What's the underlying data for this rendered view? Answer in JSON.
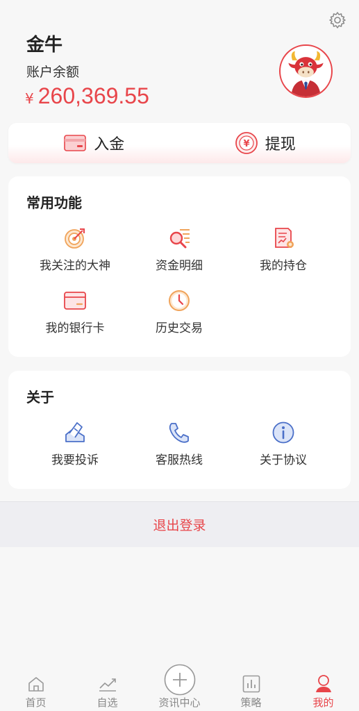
{
  "user": {
    "name": "金牛",
    "balance_label": "账户余额",
    "currency_symbol": "¥",
    "balance": "260,369.55"
  },
  "funds": {
    "deposit": "入金",
    "withdraw": "提现"
  },
  "common": {
    "title": "常用功能",
    "items": [
      {
        "label": "我关注的大神",
        "icon": "target-icon"
      },
      {
        "label": "资金明细",
        "icon": "search-list-icon"
      },
      {
        "label": "我的持仓",
        "icon": "position-doc-icon"
      },
      {
        "label": "我的银行卡",
        "icon": "bank-card-icon"
      },
      {
        "label": "历史交易",
        "icon": "clock-icon"
      }
    ]
  },
  "about": {
    "title": "关于",
    "items": [
      {
        "label": "我要投诉",
        "icon": "complaint-icon"
      },
      {
        "label": "客服热线",
        "icon": "phone-icon"
      },
      {
        "label": "关于协议",
        "icon": "info-icon"
      }
    ]
  },
  "logout": "退出登录",
  "tabs": [
    {
      "label": "首页",
      "icon": "home-icon"
    },
    {
      "label": "自选",
      "icon": "chart-line-icon"
    },
    {
      "label": "资讯中心",
      "icon": "plus-circle-icon"
    },
    {
      "label": "策略",
      "icon": "bar-chart-icon"
    },
    {
      "label": "我的",
      "icon": "person-icon",
      "active": true
    }
  ],
  "colors": {
    "accent": "#e8454a",
    "orange": "#f0a35a",
    "blue": "#4a6fc8",
    "tab_inactive": "#888888"
  }
}
